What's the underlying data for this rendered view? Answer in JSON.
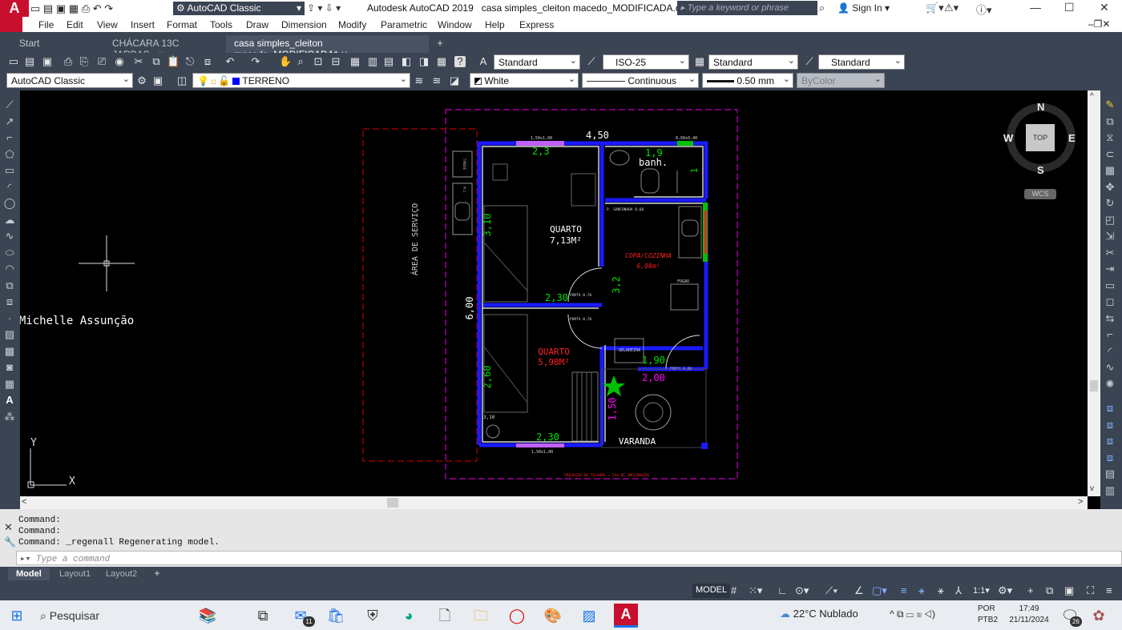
{
  "window": {
    "app_title": "Autodesk AutoCAD 2019",
    "file_title": "casa simples_cleiton macedo_MODIFICADA.dwg",
    "search_placeholder": "Type a keyword or phrase",
    "sign_in": "Sign In",
    "workspace": "AutoCAD Classic",
    "logo_letter": "A"
  },
  "menu": [
    "File",
    "Edit",
    "View",
    "Insert",
    "Format",
    "Tools",
    "Draw",
    "Dimension",
    "Modify",
    "Parametric",
    "Window",
    "Help",
    "Express"
  ],
  "doc_tabs": [
    {
      "label": "Start"
    },
    {
      "label": "CHÁCARA 13C JARBAS_"
    },
    {
      "label": "casa simples_cleiton macedo_MODIFICADA*"
    }
  ],
  "styles_toolbar": {
    "text_style": "Standard",
    "dim_style": "ISO-25",
    "table_style": "Standard",
    "mleader_style": "Standard"
  },
  "layers_toolbar": {
    "workspace": "AutoCAD Classic",
    "layer": "TERRENO",
    "color": "White",
    "linetype": "Continuous",
    "lineweight": "0.50 mm",
    "plotstyle": "ByColor"
  },
  "viewcube": {
    "n": "N",
    "s": "S",
    "e": "E",
    "w": "W",
    "top": "TOP",
    "wcs": "WCS"
  },
  "ucs": {
    "x": "X",
    "y": "Y"
  },
  "drawing": {
    "watermark": "A Michelle Assunção",
    "area_servico": "ÁREA DE SERVIÇO",
    "dim_top": "4,50",
    "dim_left": "6,00",
    "window_top": "1,50x1,00",
    "window_bath": "0,60x0,40",
    "window_bottom": "1,50x1,00",
    "q1_w": "2,3",
    "q1_h": "3,10",
    "q1_name": "QUARTO",
    "q1_area": "7,13M²",
    "q1_bw": "2,30",
    "bath_w": "1,9",
    "bath_h": "1",
    "bath_name": "banh.",
    "sanfonada": "P. SANFONADA 0,60",
    "copa_name": "COPA/COZINHA",
    "copa_area": "6,08m²",
    "copa_h": "3,2",
    "fogao": "FOGAO",
    "porta1": "PORTA 0,70",
    "porta2": "PORTA 0,70",
    "porta3": "PORTA 0,80",
    "q2_name": "QUARTO",
    "q2_area": "5,98M²",
    "q2_h": "2,60",
    "q2_w": "2,30",
    "q2_small": "3,10",
    "geladeira": "GELADEIRA",
    "dim_190": "1,90",
    "dim_200": "2,00",
    "dim_150": "1,50",
    "varanda": "VARANDA",
    "projecao": "PROJEÇÃO DO TELHADO = 25% DE INCLINAÇÃO",
    "tanque": "TANQUE",
    "maq": "M.L"
  },
  "command": {
    "lines": [
      "Command:",
      "Command:",
      "Command: _regenall Regenerating model."
    ],
    "placeholder": "Type a command"
  },
  "layout_tabs": [
    "Model",
    "Layout1",
    "Layout2"
  ],
  "status": {
    "model": "MODEL",
    "scale": "1:1"
  },
  "taskbar": {
    "search": "Pesquisar",
    "mail_badge": "11",
    "weather": "22°C  Nublado",
    "lang1": "POR",
    "lang2": "PTB2",
    "time": "17:49",
    "date": "21/11/2024",
    "notif": "26"
  },
  "colors": {
    "accent": "#c8102e",
    "wall": "#1a1aff",
    "green_dim": "#00e000",
    "magenta": "#ff00ff",
    "red_text": "#ff2020"
  }
}
